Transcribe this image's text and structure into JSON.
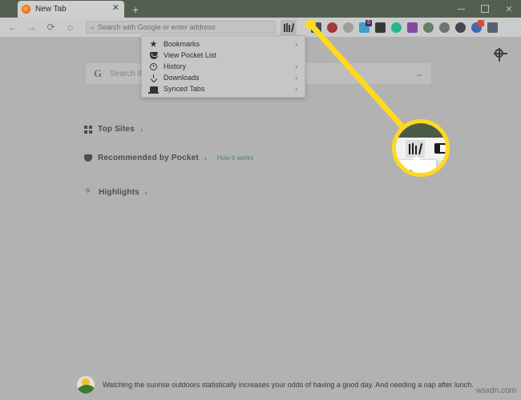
{
  "window": {
    "controls": {
      "minimize": "—",
      "maximize": "□",
      "close": "✕"
    }
  },
  "tabstrip": {
    "tab_title": "New Tab",
    "tab_close": "✕",
    "new_tab": "+"
  },
  "navbar": {
    "back": "←",
    "forward": "→",
    "reload": "⟳",
    "home": "⌂",
    "urlbar": {
      "search_icon": "⌕",
      "placeholder": "Search with Google or enter address",
      "value": ""
    },
    "library_button_label": "Library",
    "extensions": [
      {
        "name": "extension-fox",
        "color": "#3a4a3c",
        "badge": "",
        "badge_color": ""
      },
      {
        "name": "extension-shield",
        "color": "#a32a2a",
        "badge": "",
        "badge_color": ""
      },
      {
        "name": "extension-download",
        "color": "#9a9a9a",
        "badge": "",
        "badge_color": ""
      },
      {
        "name": "extension-app",
        "color": "#2da0d0",
        "badge": "0",
        "badge_color": "#4a1a5a"
      },
      {
        "name": "extension-grid",
        "color": "#2b2b2b",
        "badge": "",
        "badge_color": ""
      },
      {
        "name": "extension-sync",
        "color": "#16b48a",
        "badge": "",
        "badge_color": ""
      },
      {
        "name": "extension-onenote",
        "color": "#7b3fa0",
        "badge": "",
        "badge_color": ""
      },
      {
        "name": "extension-globe",
        "color": "#5a7a5a",
        "badge": "",
        "badge_color": ""
      },
      {
        "name": "extension-gear",
        "color": "#6a6a6a",
        "badge": "",
        "badge_color": ""
      },
      {
        "name": "extension-yinyang",
        "color": "#3a3a4a",
        "badge": "",
        "badge_color": ""
      },
      {
        "name": "extension-blue-circle",
        "color": "#3560b0",
        "badge": " ",
        "badge_color": "#e04020"
      },
      {
        "name": "extension-account",
        "color": "#4a5a6a",
        "badge": "",
        "badge_color": ""
      }
    ],
    "menu_button": "☰"
  },
  "library_menu": {
    "items": [
      {
        "label": "Bookmarks",
        "icon": "star-icon",
        "chevron": "›",
        "has_submenu": true
      },
      {
        "label": "View Pocket List",
        "icon": "pocket-icon",
        "chevron": "",
        "has_submenu": false
      },
      {
        "label": "History",
        "icon": "clock-icon",
        "chevron": "›",
        "has_submenu": true
      },
      {
        "label": "Downloads",
        "icon": "download-icon",
        "chevron": "›",
        "has_submenu": true
      },
      {
        "label": "Synced Tabs",
        "icon": "laptop-icon",
        "chevron": "›",
        "has_submenu": true
      }
    ]
  },
  "newtab": {
    "settings_icon": "gear-icon",
    "search": {
      "engine_logo": "G",
      "placeholder": "Search the Web",
      "go_arrow": "→"
    },
    "sections": [
      {
        "title": "Top Sites",
        "icon": "grid-icon",
        "chevron": "›",
        "link": ""
      },
      {
        "title": "Recommended by Pocket",
        "icon": "pocket-icon",
        "chevron": "›",
        "link": "How it works"
      },
      {
        "title": "Highlights",
        "icon": "sparkle-icon",
        "chevron": "›",
        "link": ""
      }
    ],
    "snippet": {
      "icon": "sunrise-icon",
      "text": "Watching the sunrise outdoors statistically increases your odds of having a good day. And needing a nap after lunch."
    }
  },
  "callout": {
    "highlight_color": "#ffd91e",
    "target": "library-button",
    "magnified_icons": [
      "library-books-icon",
      "sidebar-toggle-icon"
    ],
    "chevron": "›"
  },
  "watermark": "wsxdn.com"
}
